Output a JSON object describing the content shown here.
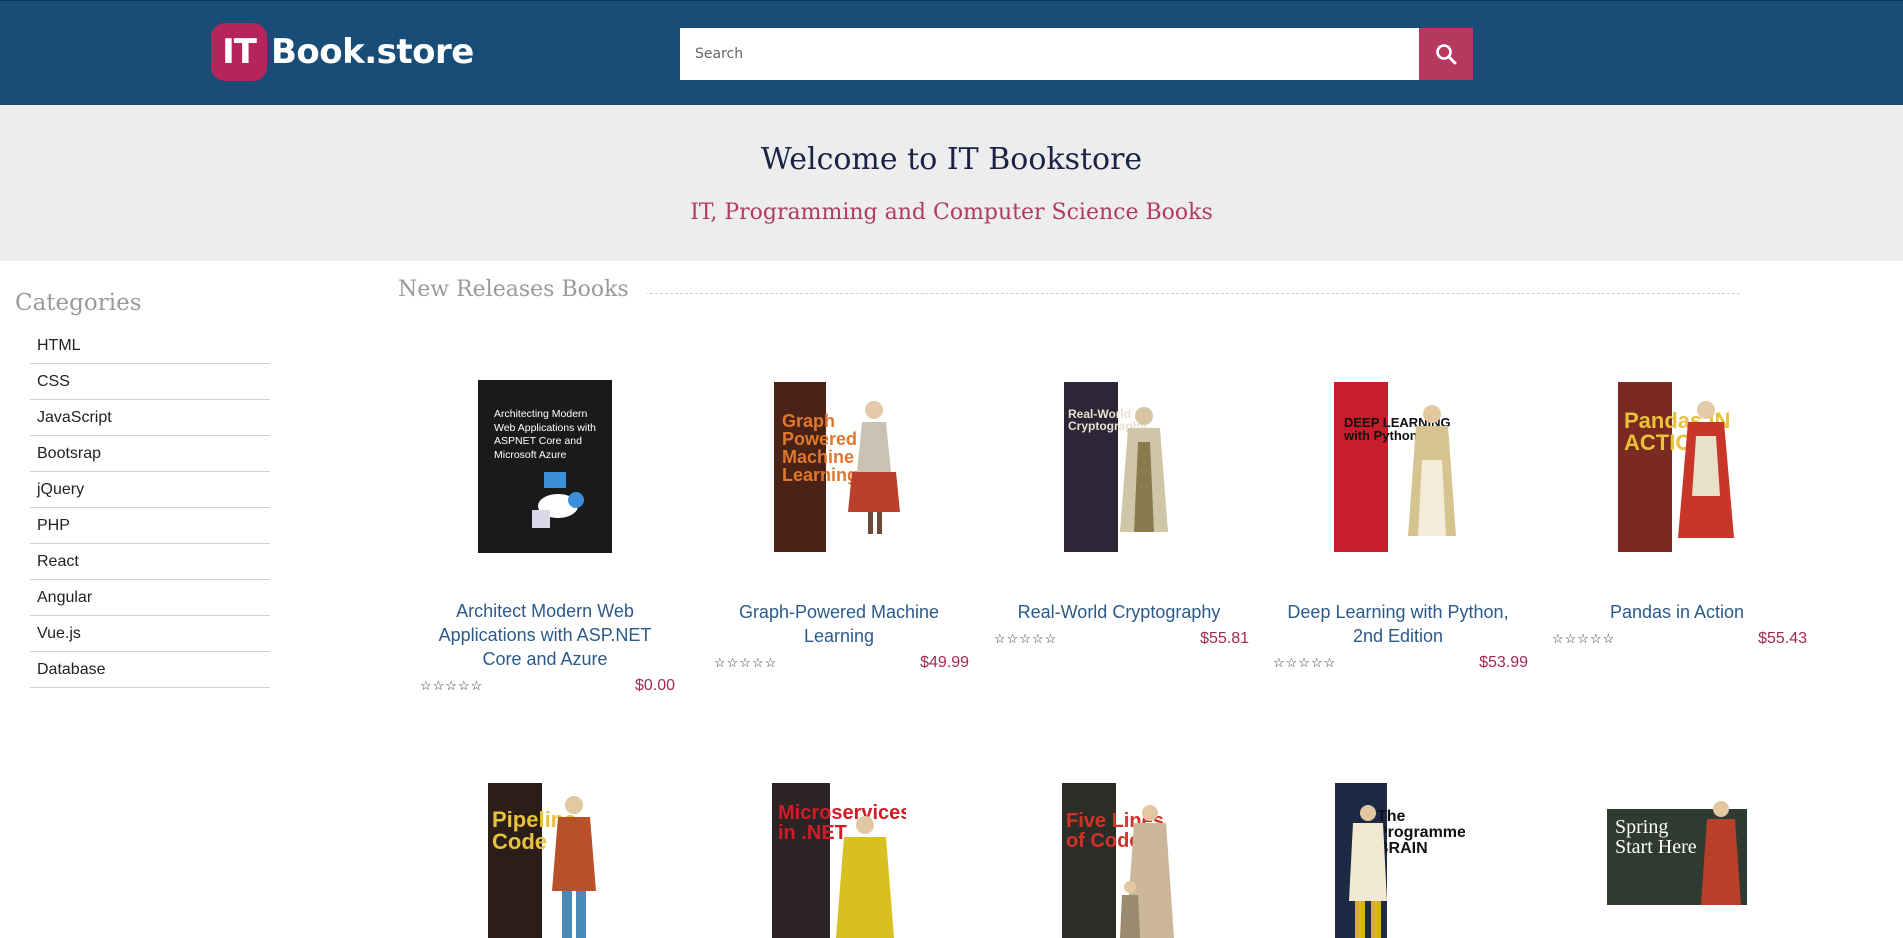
{
  "header": {
    "logo_badge": "IT",
    "logo_text": "Book.store",
    "search_placeholder": "Search",
    "search_icon": "search-icon"
  },
  "hero": {
    "title": "Welcome to IT Bookstore",
    "subtitle": "IT, Programming and Computer Science Books"
  },
  "sidebar": {
    "title": "Categories",
    "items": [
      {
        "label": "HTML"
      },
      {
        "label": "CSS"
      },
      {
        "label": "JavaScript"
      },
      {
        "label": "Bootsrap"
      },
      {
        "label": "jQuery"
      },
      {
        "label": "PHP"
      },
      {
        "label": "React"
      },
      {
        "label": "Angular"
      },
      {
        "label": "Vue.js"
      },
      {
        "label": "Database"
      }
    ]
  },
  "main": {
    "section_title": "New Releases Books",
    "books": [
      {
        "title": "Architect Modern Web Applications with ASP.NET Core and Azure",
        "stars": "☆☆☆☆☆",
        "price": "$0.00",
        "cover_text": "Architecting Modern Web Applications with ASPNET Core and Microsoft Azure",
        "cover_color": "#1a1a1a",
        "cover_text_color": "#ffffff"
      },
      {
        "title": "Graph-Powered Machine Learning",
        "stars": "☆☆☆☆☆",
        "price": "$49.99",
        "cover_text": "Graph Powered Machine Learning",
        "cover_color": "#4a2316",
        "cover_text_color": "#e0772e"
      },
      {
        "title": "Real-World Cryptography",
        "stars": "☆☆☆☆☆",
        "price": "$55.81",
        "cover_text": "Real-World Cryptography",
        "cover_color": "#2e2636",
        "cover_text_color": "#e8e0d0"
      },
      {
        "title": "Deep Learning with Python, 2nd Edition",
        "stars": "☆☆☆☆☆",
        "price": "$53.99",
        "cover_text": "DEEP LEARNING with Python",
        "cover_color": "#c81d2a",
        "cover_text_color": "#111111"
      },
      {
        "title": "Pandas in Action",
        "stars": "☆☆☆☆☆",
        "price": "$55.43",
        "cover_text": "Pandas IN ACTION",
        "cover_color": "#7a2a20",
        "cover_text_color": "#e8c23a"
      },
      {
        "title": "",
        "stars": "",
        "price": "",
        "cover_text": "Pipeline Code",
        "cover_color": "#2b1d18",
        "cover_text_color": "#e8c23a"
      },
      {
        "title": "",
        "stars": "",
        "price": "",
        "cover_text": "Microservices in .NET",
        "cover_color": "#2c2424",
        "cover_text_color": "#d01c26"
      },
      {
        "title": "",
        "stars": "",
        "price": "",
        "cover_text": "Five Lines of Code",
        "cover_color": "#2a2e26",
        "cover_text_color": "#d0322a"
      },
      {
        "title": "",
        "stars": "",
        "price": "",
        "cover_text": "The Programmer's BRAIN",
        "cover_color": "#1c2a44",
        "cover_text_color": "#ffffff"
      },
      {
        "title": "",
        "stars": "",
        "price": "",
        "cover_text": "Spring Start Here",
        "cover_color": "#2f3a30",
        "cover_text_color": "#ffffff"
      }
    ]
  },
  "colors": {
    "header_bg": "#174d77",
    "accent": "#b5245a",
    "link": "#2b5a8a",
    "price": "#a2294e"
  }
}
